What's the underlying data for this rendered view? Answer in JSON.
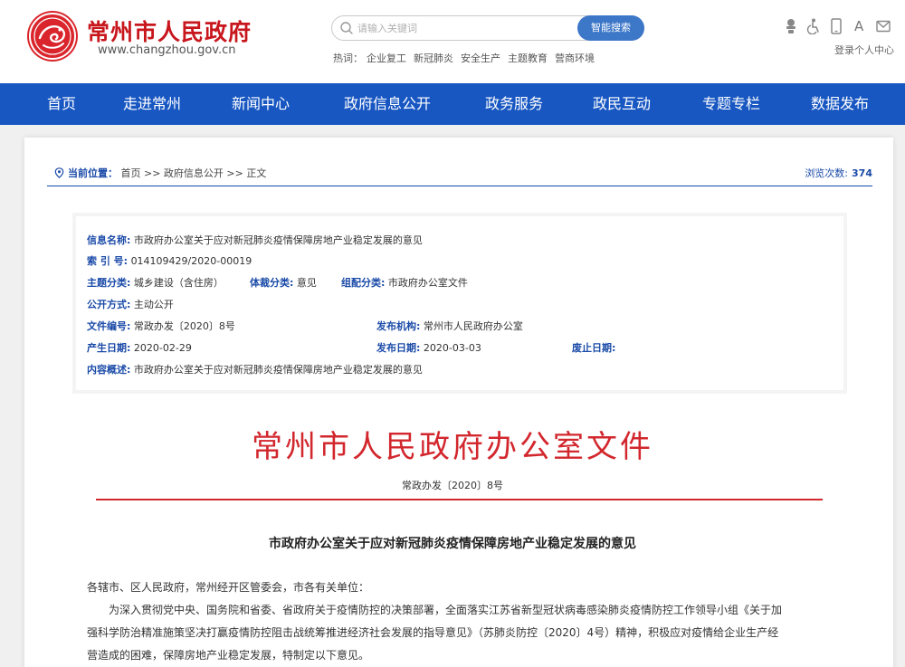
{
  "header": {
    "site_name": "常州市人民政府",
    "site_url": "www.changzhou.gov.cn",
    "search_placeholder": "请输入关键词",
    "search_button": "智能搜索",
    "hot_label": "热词：",
    "hot_words": [
      "企业复工",
      "新冠肺炎",
      "安全生产",
      "主题教育",
      "营商环境"
    ],
    "tool_font_label": "A",
    "user_center": "登录个人中心",
    "colors": {
      "brand_red": "#c8161d",
      "nav_blue": "#1857c2",
      "accent_blue": "#3c77c8"
    }
  },
  "nav": {
    "items": [
      "首页",
      "走进常州",
      "新闻中心",
      "政府信息公开",
      "政务服务",
      "政民互动",
      "专题专栏",
      "数据发布"
    ]
  },
  "location": {
    "label": "当前位置：",
    "path": "首页 >> 政府信息公开 >> 正文",
    "views_label": "浏览次数:",
    "views_count": "374"
  },
  "meta": {
    "info_name_key": "信息名称:",
    "info_name": "市政府办公室关于应对新冠肺炎疫情保障房地产业稳定发展的意见",
    "index_key": "索 引 号:",
    "index": "014109429/2020-00019",
    "topic_key": "主题分类:",
    "topic": "城乡建设（含住房）",
    "genre_key": "体裁分类:",
    "genre": "意见",
    "org_key": "组配分类:",
    "org": "市政府办公室文件",
    "open_key": "公开方式:",
    "open": "主动公开",
    "docno_key": "文件编号:",
    "docno": "常政办发〔2020〕8号",
    "publisher_key": "发布机构:",
    "publisher": "常州市人民政府办公室",
    "created_key": "产生日期:",
    "created": "2020-02-29",
    "published_key": "发布日期:",
    "published": "2020-03-03",
    "abolished_key": "废止日期:",
    "abolished": "",
    "summary_key": "内容概述:",
    "summary": "市政府办公室关于应对新冠肺炎疫情保障房地产业稳定发展的意见"
  },
  "document": {
    "head": "常州市人民政府办公室文件",
    "number": "常政办发〔2020〕8号",
    "title": "市政府办公室关于应对新冠肺炎疫情保障房地产业稳定发展的意见",
    "salutation": "各辖市、区人民政府，常州经开区管委会，市各有关单位：",
    "para_line1": "为深入贯彻党中央、国务院和省委、省政府关于疫情防控的决策部署，全面落实江苏省新型冠状病毒感染肺炎疫情防控工作领导小组《关于加",
    "para_line2": "强科学防治精准施策坚决打赢疫情防控阻击战统筹推进经济社会发展的指导意见》（苏肺炎防控〔2020〕4号）精神，积极应对疫情给企业生产经",
    "para_line3": "营造成的困难，保障房地产业稳定发展，特制定以下意见。"
  }
}
